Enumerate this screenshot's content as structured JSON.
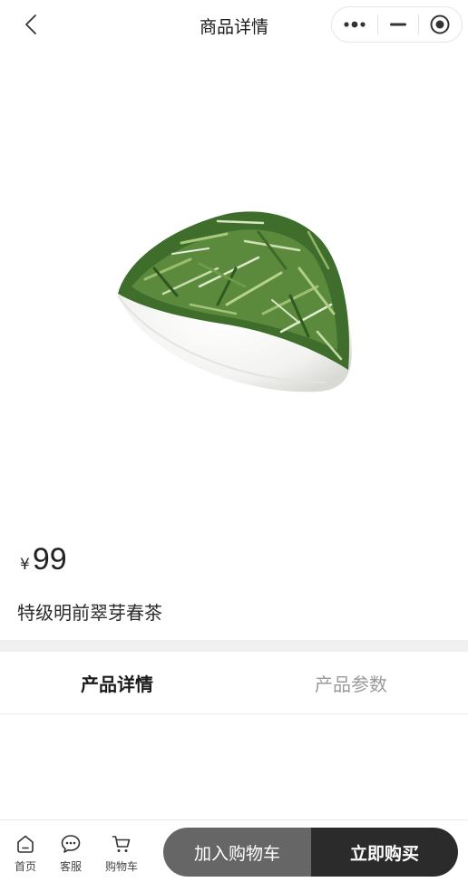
{
  "navbar": {
    "title": "商品详情",
    "back_icon": "chevron-left-icon",
    "capsule": {
      "more_icon": "more-dots-icon",
      "minimize_icon": "minimize-icon",
      "close_icon": "target-close-icon"
    }
  },
  "product": {
    "image": "green-tea-leaves-in-white-scoop",
    "price_symbol": "¥",
    "price": "99",
    "name": "特级明前翠芽春茶"
  },
  "tabs": [
    {
      "label": "产品详情",
      "active": true
    },
    {
      "label": "产品参数",
      "active": false
    }
  ],
  "bottom_bar": {
    "nav": [
      {
        "label": "首页",
        "icon": "home-icon"
      },
      {
        "label": "客服",
        "icon": "chat-icon"
      },
      {
        "label": "购物车",
        "icon": "cart-icon"
      }
    ],
    "add_to_cart": "加入购物车",
    "buy_now": "立即购买",
    "colors": {
      "cart_button": "#666666",
      "buy_button": "#2b2b2b"
    }
  }
}
